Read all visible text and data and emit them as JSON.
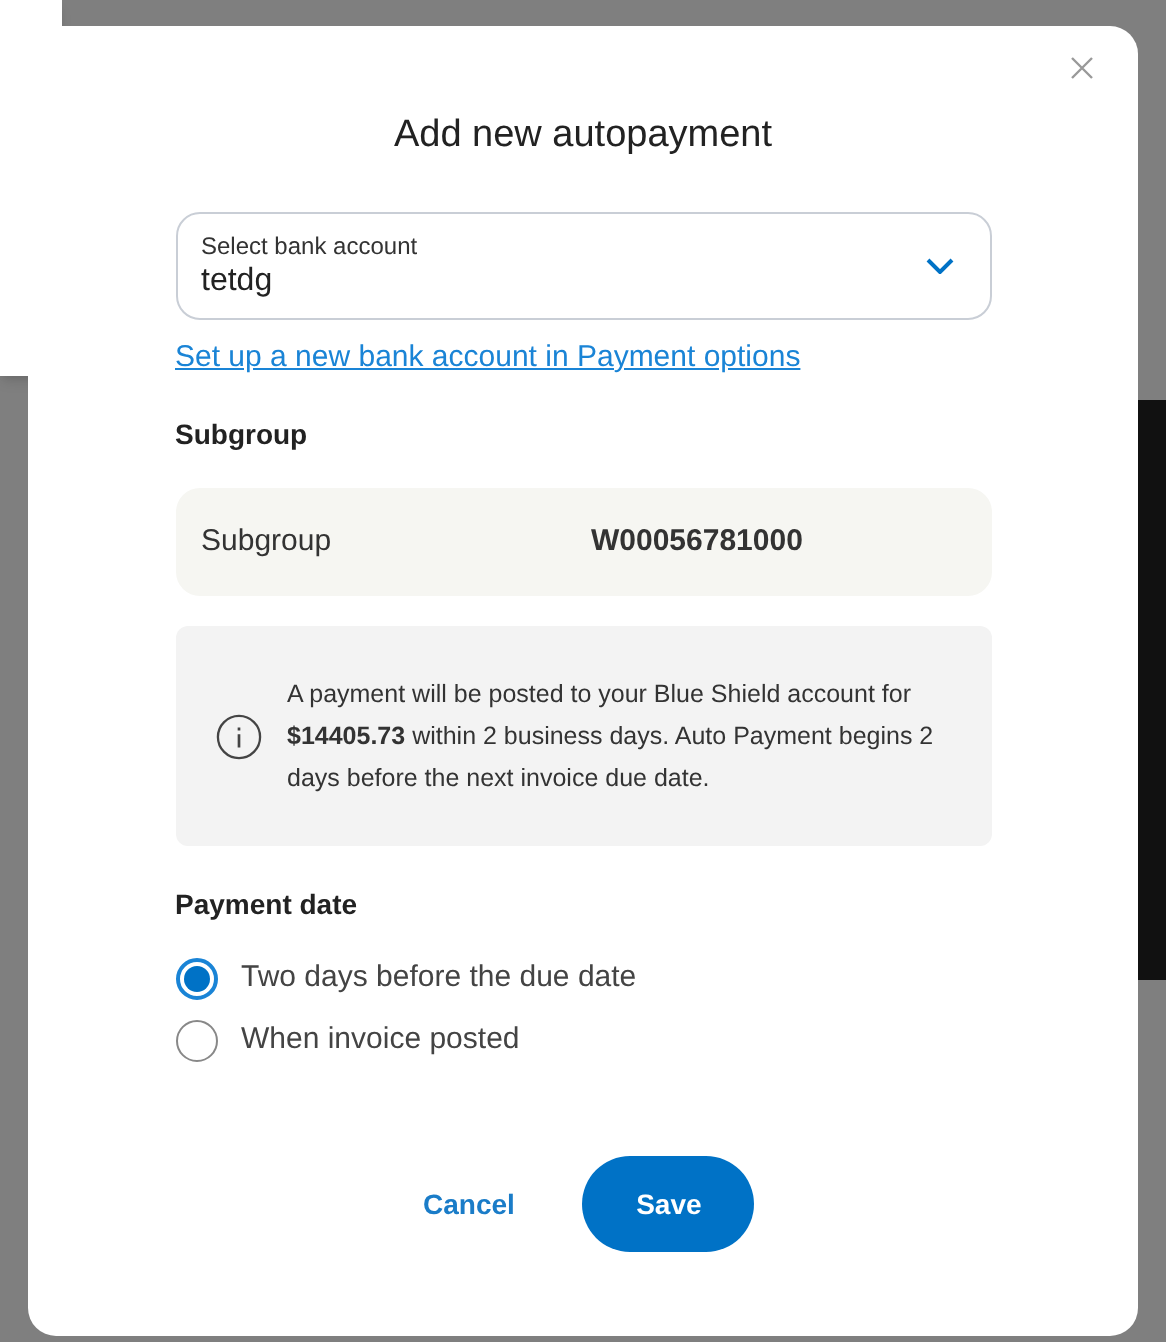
{
  "dialog": {
    "title": "Add new autopayment",
    "bank_select": {
      "label": "Select bank account",
      "value": "tetdg"
    },
    "link": "Set up a new bank account in Payment options",
    "subgroup_heading": "Subgroup",
    "subgroup": {
      "label": "Subgroup",
      "value": "W00056781000"
    },
    "info": "A payment will be posted to your Blue Shield account for **$14405.73** within 2 business days. Auto Payment begins 2 days before the next invoice due date.",
    "payment_date_heading": "Payment date",
    "payment_options": [
      {
        "label": "Two days before the due date",
        "selected": true
      },
      {
        "label": "When invoice posted",
        "selected": false
      }
    ],
    "buttons": {
      "cancel": "Cancel",
      "save": "Save"
    }
  }
}
